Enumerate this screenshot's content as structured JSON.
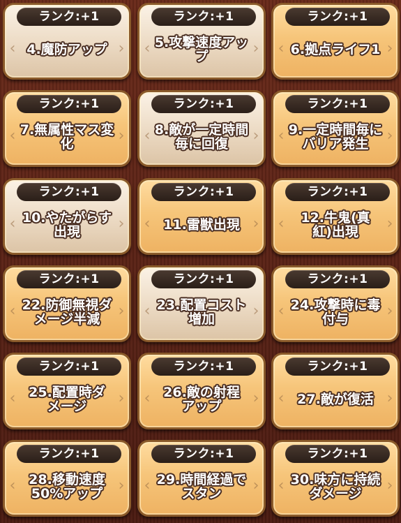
{
  "rank_label": "ランク:+1",
  "colors": {
    "orange_card": "#f6c57a",
    "beige_card": "#eddcc6",
    "rank_pill": "#2a1e18",
    "background": "#5a2417"
  },
  "cards": [
    {
      "label": "4.魔防アップ",
      "style": "beige"
    },
    {
      "label": "5.攻撃速度アッ\nプ",
      "style": "beige"
    },
    {
      "label": "6.拠点ライフ1",
      "style": "orange"
    },
    {
      "label": "7.無属性マス変\n化",
      "style": "orange"
    },
    {
      "label": "8.敵が一定時間\n毎に回復",
      "style": "beige"
    },
    {
      "label": "9.一定時間毎に\nバリア発生",
      "style": "orange"
    },
    {
      "label": "10.やたがらす\n出現",
      "style": "beige"
    },
    {
      "label": "11.雷獣出現",
      "style": "orange"
    },
    {
      "label": "12.牛鬼(真\n紅)出現",
      "style": "orange"
    },
    {
      "label": "22.防御無視ダ\nメージ半減",
      "style": "orange"
    },
    {
      "label": "23.配置コスト\n増加",
      "style": "beige"
    },
    {
      "label": "24.攻撃時に毒\n付与",
      "style": "orange"
    },
    {
      "label": "25.配置時ダ\nメージ",
      "style": "orange"
    },
    {
      "label": "26.敵の射程\nアップ",
      "style": "orange"
    },
    {
      "label": "27.敵が復活",
      "style": "orange"
    },
    {
      "label": "28.移動速度\n50%アップ",
      "style": "orange"
    },
    {
      "label": "29.時間経過で\nスタン",
      "style": "orange"
    },
    {
      "label": "30.味方に持続\nダメージ",
      "style": "orange"
    }
  ]
}
